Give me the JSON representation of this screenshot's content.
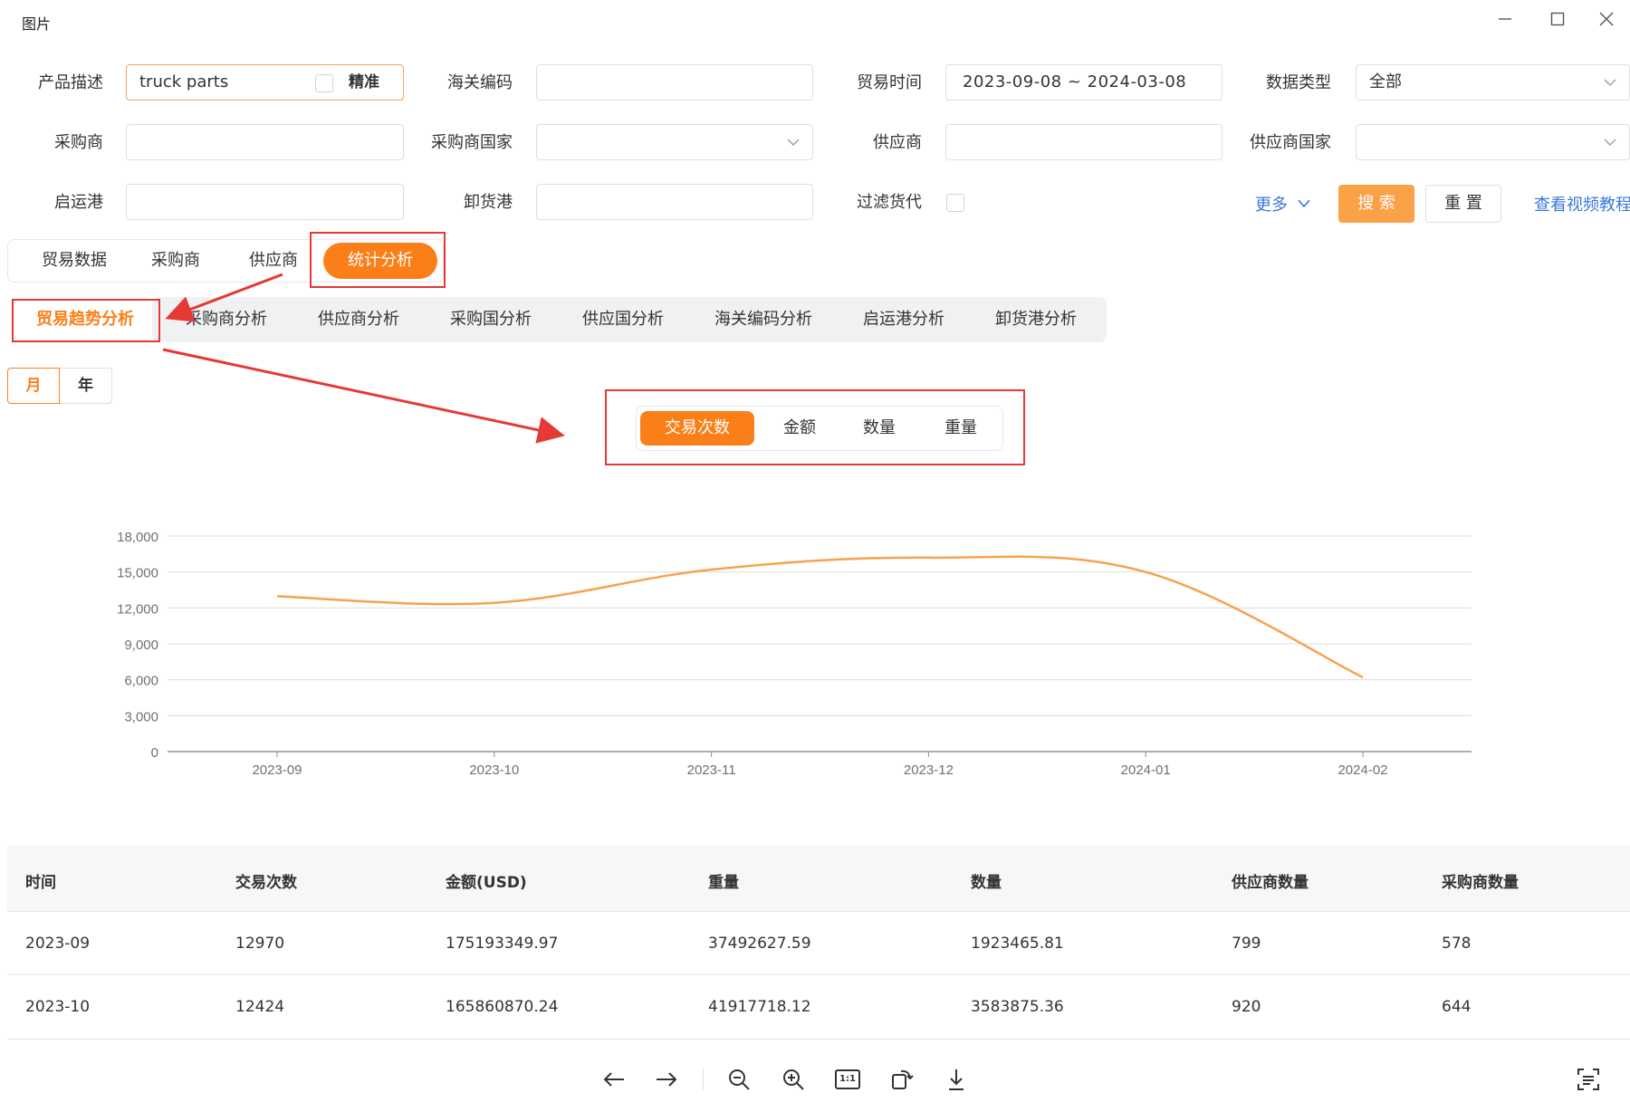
{
  "window": {
    "title": "图片"
  },
  "filters": {
    "product_desc": {
      "label": "产品描述",
      "value": "truck parts",
      "exact_label": "精准"
    },
    "hs_code": {
      "label": "海关编码",
      "value": ""
    },
    "trade_time": {
      "label": "贸易时间",
      "value": "2023-09-08 ~ 2024-03-08"
    },
    "data_type": {
      "label": "数据类型",
      "value": "全部"
    },
    "buyer": {
      "label": "采购商",
      "value": ""
    },
    "buyer_country": {
      "label": "采购商国家",
      "value": ""
    },
    "supplier": {
      "label": "供应商",
      "value": ""
    },
    "supplier_country": {
      "label": "供应商国家",
      "value": ""
    },
    "origin_port": {
      "label": "启运港",
      "value": ""
    },
    "dest_port": {
      "label": "卸货港",
      "value": ""
    },
    "filter_forwarder": {
      "label": "过滤货代"
    },
    "more_label": "更多",
    "search_label": "搜 索",
    "reset_label": "重 置",
    "video_link": "查看视频教程"
  },
  "main_tabs": [
    "贸易数据",
    "采购商",
    "供应商",
    "统计分析"
  ],
  "sub_tabs": [
    "贸易趋势分析",
    "采购商分析",
    "供应商分析",
    "采购国分析",
    "供应国分析",
    "海关编码分析",
    "启运港分析",
    "卸货港分析"
  ],
  "period_toggle": [
    "月",
    "年"
  ],
  "metric_tabs": [
    "交易次数",
    "金额",
    "数量",
    "重量"
  ],
  "colors": {
    "accent": "#fb7f18",
    "annotation": "#e53935",
    "line": "#f7a24f"
  },
  "chart_data": {
    "type": "line",
    "title": "",
    "xlabel": "",
    "ylabel": "",
    "categories": [
      "2023-09",
      "2023-10",
      "2023-11",
      "2023-12",
      "2024-01",
      "2024-02"
    ],
    "values": [
      12970,
      12424,
      15200,
      16200,
      15000,
      6200
    ],
    "ylim": [
      0,
      18000
    ],
    "yticks": [
      "0",
      "3,000",
      "6,000",
      "9,000",
      "12,000",
      "15,000",
      "18,000"
    ],
    "grid": true,
    "smooth": true
  },
  "table": {
    "headers": [
      "时间",
      "交易次数",
      "金额(USD)",
      "重量",
      "数量",
      "供应商数量",
      "采购商数量"
    ],
    "rows": [
      [
        "2023-09",
        "12970",
        "175193349.97",
        "37492627.59",
        "1923465.81",
        "799",
        "578"
      ],
      [
        "2023-10",
        "12424",
        "165860870.24",
        "41917718.12",
        "3583875.36",
        "920",
        "644"
      ]
    ]
  },
  "viewer_tools": [
    "arrow-left-icon",
    "arrow-right-icon",
    "zoom-out-icon",
    "zoom-in-icon",
    "actual-size-icon",
    "rotate-icon",
    "download-icon",
    "ocr-icon"
  ],
  "viewer_actual_size_text": "1:1"
}
